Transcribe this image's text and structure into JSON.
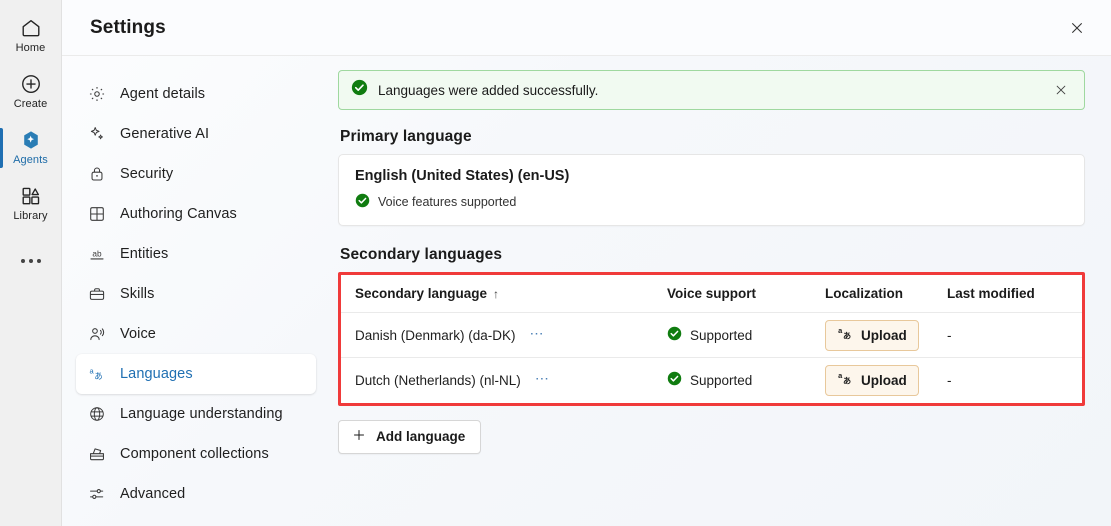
{
  "app_rail": {
    "items": [
      {
        "label": "Home",
        "icon": "home-icon",
        "selected": false
      },
      {
        "label": "Create",
        "icon": "plus-circle-icon",
        "selected": false
      },
      {
        "label": "Agents",
        "icon": "agents-sparkle-icon",
        "selected": true
      },
      {
        "label": "Library",
        "icon": "library-icon",
        "selected": false
      }
    ],
    "overflow_icon": "more-horizontal-icon"
  },
  "panel": {
    "title": "Settings",
    "close_icon": "close-icon"
  },
  "settings_nav": {
    "items": [
      {
        "label": "Agent details",
        "icon": "gear-icon",
        "selected": false
      },
      {
        "label": "Generative AI",
        "icon": "sparkle-icon",
        "selected": false
      },
      {
        "label": "Security",
        "icon": "lock-icon",
        "selected": false
      },
      {
        "label": "Authoring Canvas",
        "icon": "grid-icon",
        "selected": false
      },
      {
        "label": "Entities",
        "icon": "ab-text-icon",
        "selected": false
      },
      {
        "label": "Skills",
        "icon": "briefcase-icon",
        "selected": false
      },
      {
        "label": "Voice",
        "icon": "voice-person-icon",
        "selected": false
      },
      {
        "label": "Languages",
        "icon": "local-language-icon",
        "selected": true
      },
      {
        "label": "Language understanding",
        "icon": "globe-brain-icon",
        "selected": false
      },
      {
        "label": "Component collections",
        "icon": "toolbox-icon",
        "selected": false
      },
      {
        "label": "Advanced",
        "icon": "sliders-icon",
        "selected": false
      }
    ]
  },
  "banner": {
    "icon": "success-check-icon",
    "message": "Languages were added successfully.",
    "close_icon": "close-icon",
    "background": "#f1faf1",
    "border": "#9fd89f",
    "accent": "#107c10"
  },
  "primary_language": {
    "heading": "Primary language",
    "name": "English (United States) (en-US)",
    "status_icon": "success-check-icon",
    "status_text": "Voice features supported"
  },
  "secondary_languages": {
    "heading": "Secondary languages",
    "highlight_color": "#f03a3a",
    "columns": [
      {
        "label": "Secondary language",
        "sort": "↑"
      },
      {
        "label": "Voice support"
      },
      {
        "label": "Localization"
      },
      {
        "label": "Last modified"
      }
    ],
    "rows": [
      {
        "language": "Danish (Denmark) (da-DK)",
        "overflow_icon": "more-horizontal-icon",
        "voice_support": "Supported",
        "voice_icon": "success-check-icon",
        "localization_label": "Upload",
        "localization_icon": "local-language-icon",
        "last_modified": "-"
      },
      {
        "language": "Dutch (Netherlands) (nl-NL)",
        "overflow_icon": "more-horizontal-icon",
        "voice_support": "Supported",
        "voice_icon": "success-check-icon",
        "localization_label": "Upload",
        "localization_icon": "local-language-icon",
        "last_modified": "-"
      }
    ],
    "add_button": {
      "label": "Add language",
      "icon": "plus-icon"
    }
  }
}
